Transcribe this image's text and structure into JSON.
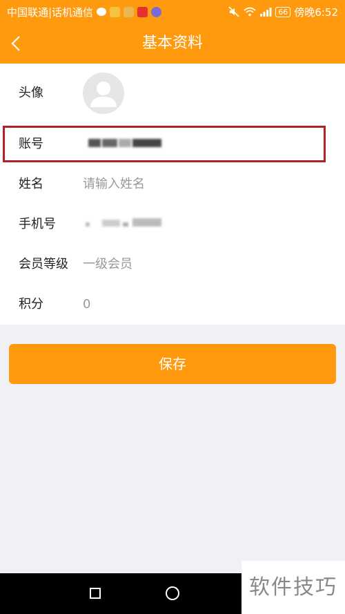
{
  "status_bar": {
    "carrier": "中国联通|话机通信",
    "time": "傍晚6:52",
    "battery": "66"
  },
  "header": {
    "title": "基本资料"
  },
  "form": {
    "avatar_label": "头像",
    "account_label": "账号",
    "name_label": "姓名",
    "name_placeholder": "请输入姓名",
    "phone_label": "手机号",
    "level_label": "会员等级",
    "level_value": "一级会员",
    "points_label": "积分",
    "points_value": "0"
  },
  "actions": {
    "save_label": "保存"
  },
  "watermark": "软件技巧",
  "colors": {
    "accent": "#ff9a0e",
    "highlight_border": "#b32025"
  }
}
